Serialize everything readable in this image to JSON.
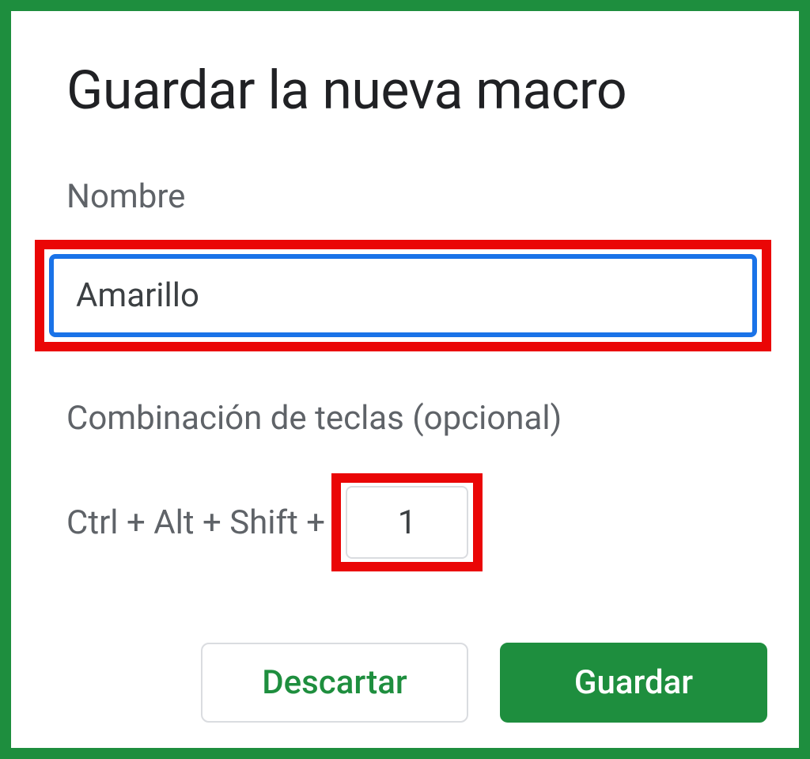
{
  "dialog": {
    "title": "Guardar la nueva macro",
    "name_label": "Nombre",
    "name_value": "Amarillo",
    "shortcut_label": "Combinación de teclas (opcional)",
    "shortcut_prefix": "Ctrl + Alt + Shift + ",
    "shortcut_value": "1",
    "discard_label": "Descartar",
    "save_label": "Guardar"
  }
}
